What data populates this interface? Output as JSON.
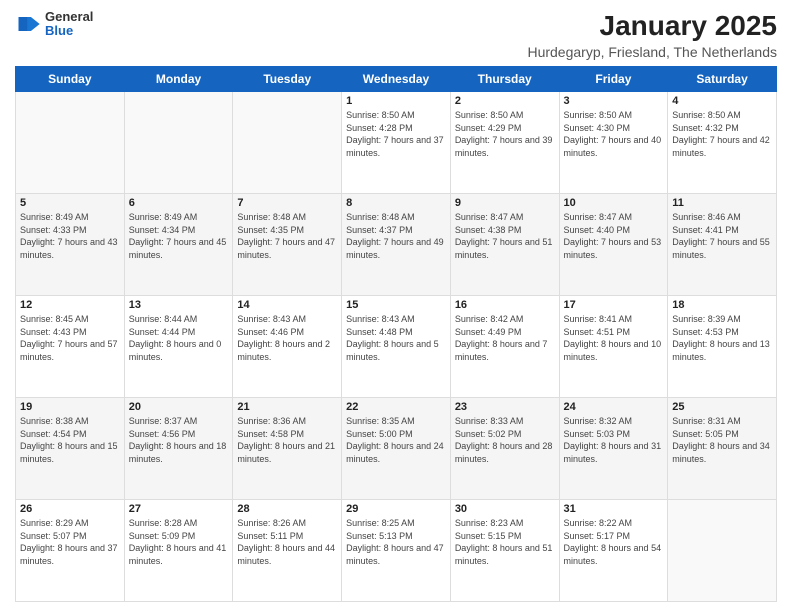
{
  "header": {
    "logo": {
      "general": "General",
      "blue": "Blue"
    },
    "title": "January 2025",
    "subtitle": "Hurdegaryp, Friesland, The Netherlands"
  },
  "weekdays": [
    "Sunday",
    "Monday",
    "Tuesday",
    "Wednesday",
    "Thursday",
    "Friday",
    "Saturday"
  ],
  "weeks": [
    [
      {
        "date": "",
        "sunrise": "",
        "sunset": "",
        "daylight": ""
      },
      {
        "date": "",
        "sunrise": "",
        "sunset": "",
        "daylight": ""
      },
      {
        "date": "",
        "sunrise": "",
        "sunset": "",
        "daylight": ""
      },
      {
        "date": "1",
        "sunrise": "Sunrise: 8:50 AM",
        "sunset": "Sunset: 4:28 PM",
        "daylight": "Daylight: 7 hours and 37 minutes."
      },
      {
        "date": "2",
        "sunrise": "Sunrise: 8:50 AM",
        "sunset": "Sunset: 4:29 PM",
        "daylight": "Daylight: 7 hours and 39 minutes."
      },
      {
        "date": "3",
        "sunrise": "Sunrise: 8:50 AM",
        "sunset": "Sunset: 4:30 PM",
        "daylight": "Daylight: 7 hours and 40 minutes."
      },
      {
        "date": "4",
        "sunrise": "Sunrise: 8:50 AM",
        "sunset": "Sunset: 4:32 PM",
        "daylight": "Daylight: 7 hours and 42 minutes."
      }
    ],
    [
      {
        "date": "5",
        "sunrise": "Sunrise: 8:49 AM",
        "sunset": "Sunset: 4:33 PM",
        "daylight": "Daylight: 7 hours and 43 minutes."
      },
      {
        "date": "6",
        "sunrise": "Sunrise: 8:49 AM",
        "sunset": "Sunset: 4:34 PM",
        "daylight": "Daylight: 7 hours and 45 minutes."
      },
      {
        "date": "7",
        "sunrise": "Sunrise: 8:48 AM",
        "sunset": "Sunset: 4:35 PM",
        "daylight": "Daylight: 7 hours and 47 minutes."
      },
      {
        "date": "8",
        "sunrise": "Sunrise: 8:48 AM",
        "sunset": "Sunset: 4:37 PM",
        "daylight": "Daylight: 7 hours and 49 minutes."
      },
      {
        "date": "9",
        "sunrise": "Sunrise: 8:47 AM",
        "sunset": "Sunset: 4:38 PM",
        "daylight": "Daylight: 7 hours and 51 minutes."
      },
      {
        "date": "10",
        "sunrise": "Sunrise: 8:47 AM",
        "sunset": "Sunset: 4:40 PM",
        "daylight": "Daylight: 7 hours and 53 minutes."
      },
      {
        "date": "11",
        "sunrise": "Sunrise: 8:46 AM",
        "sunset": "Sunset: 4:41 PM",
        "daylight": "Daylight: 7 hours and 55 minutes."
      }
    ],
    [
      {
        "date": "12",
        "sunrise": "Sunrise: 8:45 AM",
        "sunset": "Sunset: 4:43 PM",
        "daylight": "Daylight: 7 hours and 57 minutes."
      },
      {
        "date": "13",
        "sunrise": "Sunrise: 8:44 AM",
        "sunset": "Sunset: 4:44 PM",
        "daylight": "Daylight: 8 hours and 0 minutes."
      },
      {
        "date": "14",
        "sunrise": "Sunrise: 8:43 AM",
        "sunset": "Sunset: 4:46 PM",
        "daylight": "Daylight: 8 hours and 2 minutes."
      },
      {
        "date": "15",
        "sunrise": "Sunrise: 8:43 AM",
        "sunset": "Sunset: 4:48 PM",
        "daylight": "Daylight: 8 hours and 5 minutes."
      },
      {
        "date": "16",
        "sunrise": "Sunrise: 8:42 AM",
        "sunset": "Sunset: 4:49 PM",
        "daylight": "Daylight: 8 hours and 7 minutes."
      },
      {
        "date": "17",
        "sunrise": "Sunrise: 8:41 AM",
        "sunset": "Sunset: 4:51 PM",
        "daylight": "Daylight: 8 hours and 10 minutes."
      },
      {
        "date": "18",
        "sunrise": "Sunrise: 8:39 AM",
        "sunset": "Sunset: 4:53 PM",
        "daylight": "Daylight: 8 hours and 13 minutes."
      }
    ],
    [
      {
        "date": "19",
        "sunrise": "Sunrise: 8:38 AM",
        "sunset": "Sunset: 4:54 PM",
        "daylight": "Daylight: 8 hours and 15 minutes."
      },
      {
        "date": "20",
        "sunrise": "Sunrise: 8:37 AM",
        "sunset": "Sunset: 4:56 PM",
        "daylight": "Daylight: 8 hours and 18 minutes."
      },
      {
        "date": "21",
        "sunrise": "Sunrise: 8:36 AM",
        "sunset": "Sunset: 4:58 PM",
        "daylight": "Daylight: 8 hours and 21 minutes."
      },
      {
        "date": "22",
        "sunrise": "Sunrise: 8:35 AM",
        "sunset": "Sunset: 5:00 PM",
        "daylight": "Daylight: 8 hours and 24 minutes."
      },
      {
        "date": "23",
        "sunrise": "Sunrise: 8:33 AM",
        "sunset": "Sunset: 5:02 PM",
        "daylight": "Daylight: 8 hours and 28 minutes."
      },
      {
        "date": "24",
        "sunrise": "Sunrise: 8:32 AM",
        "sunset": "Sunset: 5:03 PM",
        "daylight": "Daylight: 8 hours and 31 minutes."
      },
      {
        "date": "25",
        "sunrise": "Sunrise: 8:31 AM",
        "sunset": "Sunset: 5:05 PM",
        "daylight": "Daylight: 8 hours and 34 minutes."
      }
    ],
    [
      {
        "date": "26",
        "sunrise": "Sunrise: 8:29 AM",
        "sunset": "Sunset: 5:07 PM",
        "daylight": "Daylight: 8 hours and 37 minutes."
      },
      {
        "date": "27",
        "sunrise": "Sunrise: 8:28 AM",
        "sunset": "Sunset: 5:09 PM",
        "daylight": "Daylight: 8 hours and 41 minutes."
      },
      {
        "date": "28",
        "sunrise": "Sunrise: 8:26 AM",
        "sunset": "Sunset: 5:11 PM",
        "daylight": "Daylight: 8 hours and 44 minutes."
      },
      {
        "date": "29",
        "sunrise": "Sunrise: 8:25 AM",
        "sunset": "Sunset: 5:13 PM",
        "daylight": "Daylight: 8 hours and 47 minutes."
      },
      {
        "date": "30",
        "sunrise": "Sunrise: 8:23 AM",
        "sunset": "Sunset: 5:15 PM",
        "daylight": "Daylight: 8 hours and 51 minutes."
      },
      {
        "date": "31",
        "sunrise": "Sunrise: 8:22 AM",
        "sunset": "Sunset: 5:17 PM",
        "daylight": "Daylight: 8 hours and 54 minutes."
      },
      {
        "date": "",
        "sunrise": "",
        "sunset": "",
        "daylight": ""
      }
    ]
  ]
}
